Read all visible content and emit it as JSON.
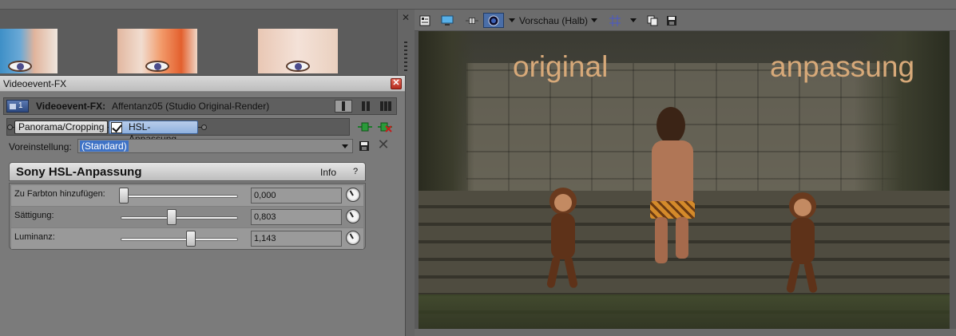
{
  "preview": {
    "toolbar": {
      "quality_label": "Vorschau (Halb)"
    },
    "overlay_text_left": "original",
    "overlay_text_right": "anpassung"
  },
  "dialog": {
    "title": "Videoevent-FX",
    "header": {
      "track_number": "1",
      "label": "Videoevent-FX:",
      "value": "Affentanz05 (Studio Original-Render)"
    },
    "chain": {
      "plugins": [
        {
          "label": "Panorama/Cropping"
        },
        {
          "label": "HSL-Anpassung",
          "checked": true
        }
      ]
    },
    "preset": {
      "label": "Voreinstellung:",
      "value": "(Standard)"
    },
    "panel": {
      "title": "Sony HSL-Anpassung",
      "info_label": "Info",
      "help_label": "?",
      "params": [
        {
          "label": "Zu Farbton hinzufügen:",
          "value": "0,000",
          "level": 0.0
        },
        {
          "label": "Sättigung:",
          "value": "0,803",
          "level": 0.41
        },
        {
          "label": "Luminanz:",
          "value": "1,143",
          "level": 0.57
        }
      ]
    }
  },
  "colors": {
    "selection": "#3f73c6",
    "overlay_text": "#d7a979",
    "close_button": "#c8392b"
  }
}
